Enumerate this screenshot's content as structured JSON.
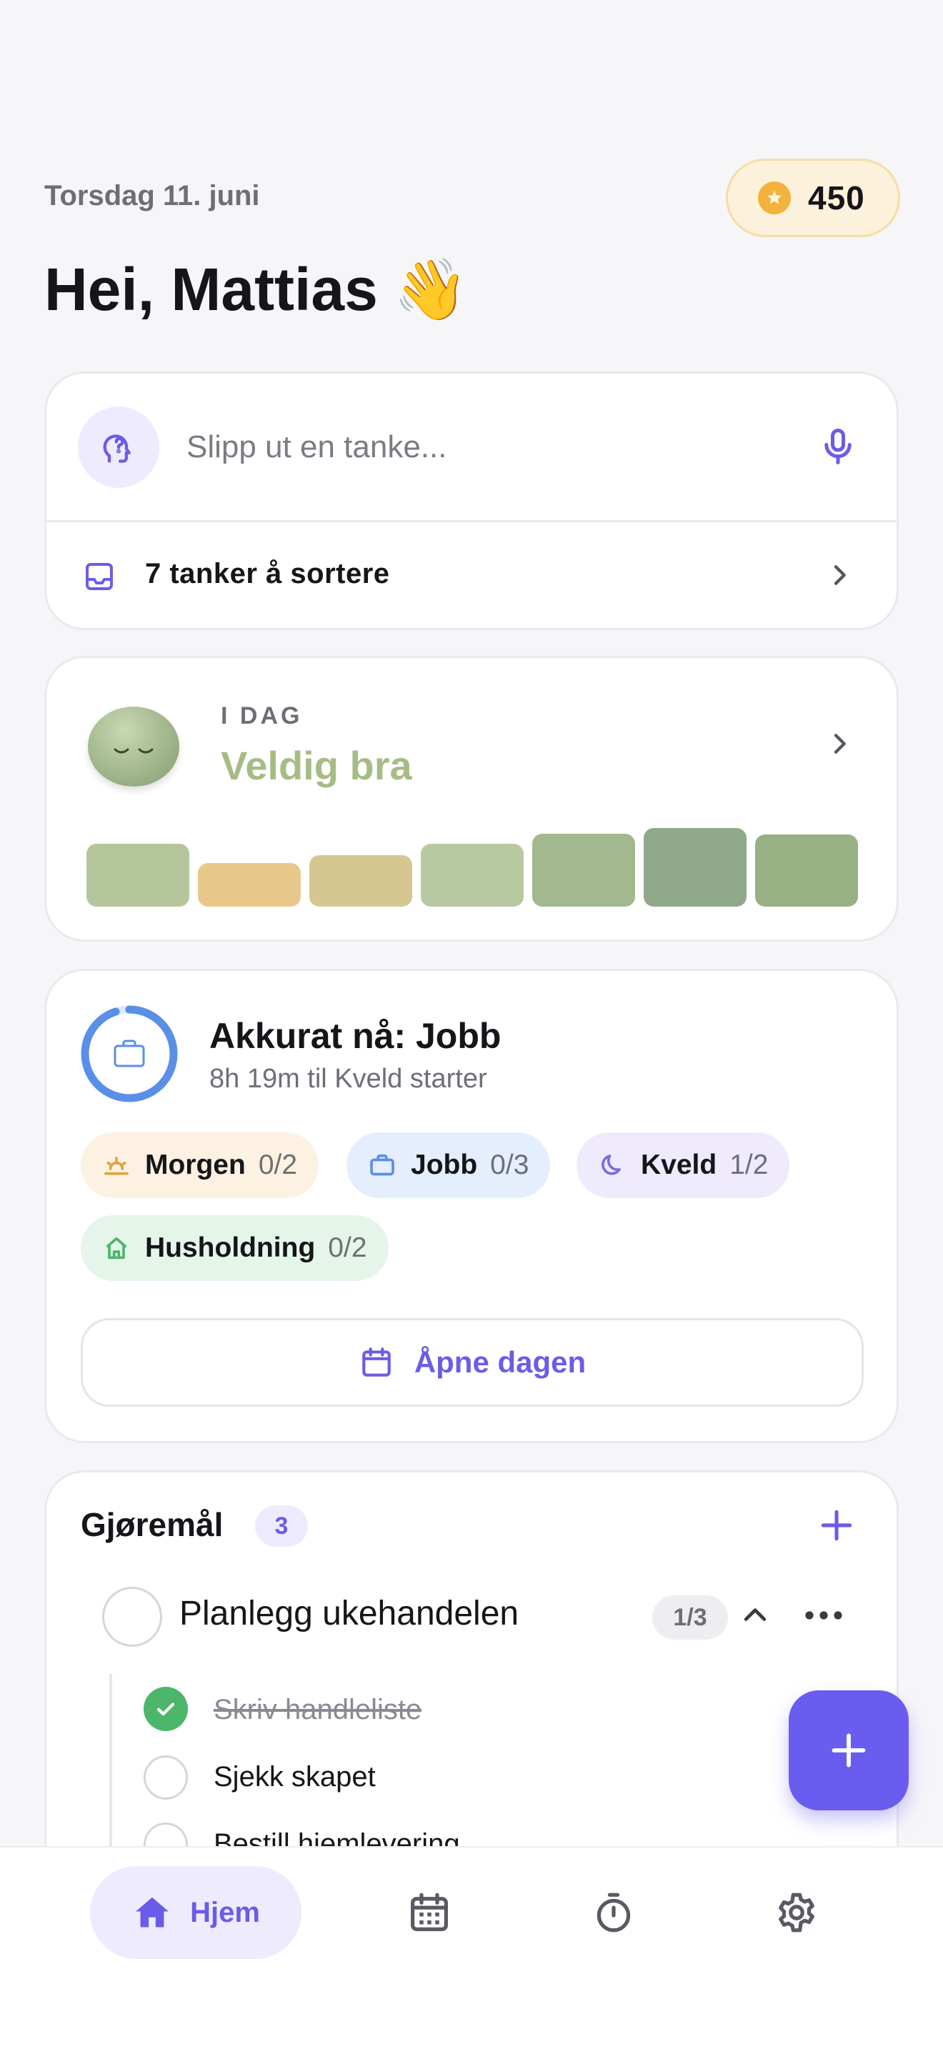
{
  "header": {
    "date": "Torsdag 11. juni",
    "coins": "450",
    "greeting": "Hei, Mattias",
    "greeting_emoji": "👋"
  },
  "thoughts": {
    "placeholder": "Slipp ut en tanke...",
    "inbox_label": "7 tanker å sortere"
  },
  "mood": {
    "label": "I DAG",
    "value": "Veldig bra",
    "bars": [
      {
        "level": 0.8,
        "color": "#B5C69D"
      },
      {
        "level": 0.55,
        "color": "#E8C88A"
      },
      {
        "level": 0.65,
        "color": "#D5C78F"
      },
      {
        "level": 0.8,
        "color": "#B8C9A1"
      },
      {
        "level": 0.93,
        "color": "#A2B88E"
      },
      {
        "level": 1.0,
        "color": "#8FA98A"
      },
      {
        "level": 0.92,
        "color": "#97B084"
      }
    ]
  },
  "current": {
    "title": "Akkurat nå: Jobb",
    "subtitle": "8h 19m til Kveld starter",
    "progress": 0.95,
    "pills": [
      {
        "name": "Morgen",
        "count": "0/2",
        "bg": "#FDF1E2",
        "icon": "sunrise-icon",
        "color": "#E2A23B"
      },
      {
        "name": "Jobb",
        "count": "0/3",
        "bg": "#E5EEFC",
        "icon": "briefcase-icon",
        "color": "#5A8FE8"
      },
      {
        "name": "Kveld",
        "count": "1/2",
        "bg": "#EFEBFD",
        "icon": "moon-icon",
        "color": "#7C6AE0"
      },
      {
        "name": "Husholdning",
        "count": "0/2",
        "bg": "#E5F5EA",
        "icon": "house-icon",
        "color": "#4CB66A"
      }
    ],
    "open_day_label": "Åpne dagen"
  },
  "tasks": {
    "title": "Gjøremål",
    "count": "3",
    "main_task": "Planlegg ukehandelen",
    "progress": "1/3",
    "subtasks": [
      {
        "label": "Skriv handleliste",
        "done": true
      },
      {
        "label": "Sjekk skapet",
        "done": false
      },
      {
        "label": "Bestill hjemlevering",
        "done": false
      }
    ]
  },
  "tabbar": {
    "home_label": "Hjem"
  },
  "colors": {
    "accent": "#6B5CE7",
    "mood_text": "#A6BC85"
  }
}
